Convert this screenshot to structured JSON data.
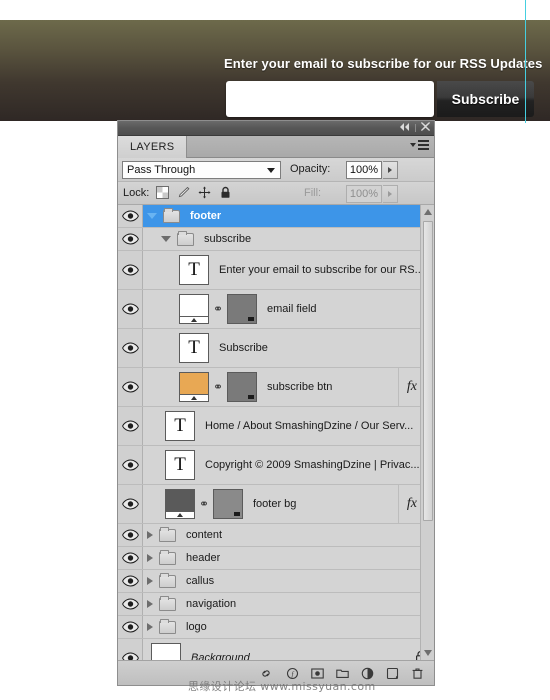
{
  "banner": {
    "headline": "Enter your email to subscribe for our RSS Updates",
    "email_placeholder": "",
    "email_value": "",
    "subscribe_label": "Subscribe",
    "gradient_top": "#6d6a4b",
    "gradient_bottom": "#2f2825",
    "guide_color": "#45cfe0"
  },
  "panel": {
    "titlebar": {
      "collapse_icon": "«",
      "close_icon": "✕"
    },
    "tab_label": "LAYERS",
    "blend_mode": "Pass Through",
    "opacity_label": "Opacity:",
    "opacity_value": "100%",
    "lock_label": "Lock:",
    "lock_icons": [
      "lock-transparency-icon",
      "lock-image-pixels-icon",
      "lock-position-icon",
      "lock-all-icon"
    ],
    "fill_label": "Fill:",
    "fill_value": "100%",
    "selection_color": "#3d95e8",
    "footer_icons": [
      "link-layers-icon",
      "add-layer-style-icon",
      "add-mask-icon",
      "new-group-icon",
      "new-adjustment-icon",
      "new-layer-icon",
      "delete-layer-icon"
    ]
  },
  "layers": [
    {
      "name": "footer",
      "type": "group",
      "indent": 0,
      "selected": true,
      "expanded": true,
      "visible": true,
      "tall": false,
      "fx": false,
      "locked": false
    },
    {
      "name": "subscribe",
      "type": "group",
      "indent": 1,
      "selected": false,
      "expanded": true,
      "visible": true,
      "tall": false,
      "fx": false,
      "locked": false
    },
    {
      "name": "Enter your email to subscribe for our RS...",
      "type": "text",
      "indent": 2,
      "selected": false,
      "visible": true,
      "tall": true,
      "fx": false,
      "locked": false
    },
    {
      "name": "email field",
      "type": "masked",
      "indent": 2,
      "selected": false,
      "visible": true,
      "tall": true,
      "fx": false,
      "locked": false,
      "thumb_color": "#ffffff",
      "mask_color": "#7a7a7a"
    },
    {
      "name": "Subscribe",
      "type": "text",
      "indent": 2,
      "selected": false,
      "visible": true,
      "tall": true,
      "fx": false,
      "locked": false
    },
    {
      "name": "subscribe btn",
      "type": "masked",
      "indent": 2,
      "selected": false,
      "visible": true,
      "tall": true,
      "fx": true,
      "locked": false,
      "thumb_color": "#e8a854",
      "mask_color": "#7a7a7a"
    },
    {
      "name": "Home  /  About SmashingDzine  /  Our Serv...",
      "type": "text",
      "indent": 1,
      "selected": false,
      "visible": true,
      "tall": true,
      "fx": false,
      "locked": false
    },
    {
      "name": "Copyright © 2009 SmashingDzine  |  Privac...",
      "type": "text",
      "indent": 1,
      "selected": false,
      "visible": true,
      "tall": true,
      "fx": false,
      "locked": false
    },
    {
      "name": "footer bg",
      "type": "masked",
      "indent": 1,
      "selected": false,
      "visible": true,
      "tall": true,
      "fx": true,
      "locked": false,
      "thumb_color": "#5a5a5a",
      "mask_color": "#8a8a8a"
    },
    {
      "name": "content",
      "type": "group",
      "indent": 0,
      "selected": false,
      "expanded": false,
      "visible": true,
      "tall": false,
      "fx": false,
      "locked": false
    },
    {
      "name": "header",
      "type": "group",
      "indent": 0,
      "selected": false,
      "expanded": false,
      "visible": true,
      "tall": false,
      "fx": false,
      "locked": false
    },
    {
      "name": "callus",
      "type": "group",
      "indent": 0,
      "selected": false,
      "expanded": false,
      "visible": true,
      "tall": false,
      "fx": false,
      "locked": false
    },
    {
      "name": "navigation",
      "type": "group",
      "indent": 0,
      "selected": false,
      "expanded": false,
      "visible": true,
      "tall": false,
      "fx": false,
      "locked": false
    },
    {
      "name": "logo",
      "type": "group",
      "indent": 0,
      "selected": false,
      "expanded": false,
      "visible": true,
      "tall": false,
      "fx": false,
      "locked": false
    },
    {
      "name": "Background",
      "type": "bitmap",
      "indent": 0,
      "selected": false,
      "visible": true,
      "tall": true,
      "fx": false,
      "locked": true,
      "italic": true,
      "thumb_color": "#ffffff"
    }
  ],
  "watermark": {
    "text": "思缘设计论坛  www.missyuan.com"
  }
}
